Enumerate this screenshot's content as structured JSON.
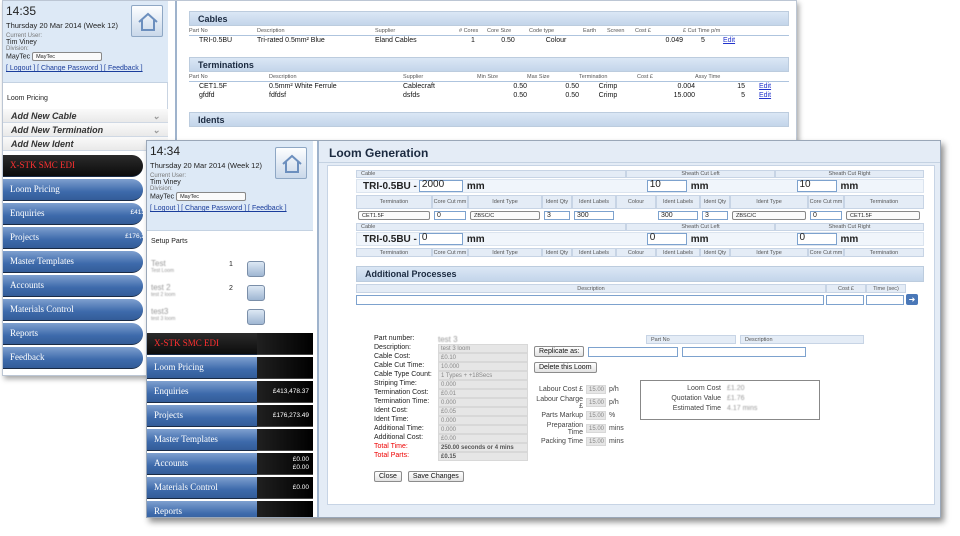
{
  "back_window": {
    "clock": "14:35",
    "date": "Thursday 20 Mar 2014 (Week 12)",
    "current_user_label": "Current User:",
    "user": "Tim Viney",
    "division_label": "Division:",
    "division": "MayTec",
    "division_select": "MayTec",
    "links": "[ Logout ] [ Change Password ] [ Feedback ]",
    "sidebar_title": "Loom Pricing",
    "add_items": [
      "Add New Cable",
      "Add New Termination",
      "Add New Ident"
    ],
    "nav": [
      "X-STK SMC EDI",
      "Loom Pricing",
      "Enquiries",
      "Projects",
      "Master Templates",
      "Accounts",
      "Materials Control",
      "Reports",
      "Feedback"
    ],
    "nav_values": [
      "",
      "",
      "£413",
      "£176,2",
      "",
      "",
      "",
      "",
      ""
    ],
    "cables": {
      "title": "Cables",
      "columns": [
        "Part No",
        "Description",
        "Supplier",
        "# Cores",
        "Core Size",
        "Code type",
        "Earth",
        "Screen",
        "Cost £",
        "£ Cut Time p/m"
      ],
      "row": [
        "TRI-0.5BU",
        "Tri-rated 0.5mm² Blue",
        "Eland Cables",
        "1",
        "0.50",
        "Colour",
        "",
        "",
        "0.049",
        "5"
      ],
      "edit": "Edit"
    },
    "terminations": {
      "title": "Terminations",
      "columns": [
        "Part No",
        "Description",
        "Supplier",
        "Min Size",
        "Max Size",
        "Termination",
        "Cost £",
        "Assy Time"
      ],
      "rows": [
        [
          "CET1.5F",
          "0.5mm² White Ferrule",
          "Cablecraft",
          "0.50",
          "0.50",
          "Crimp",
          "0.004",
          "15"
        ],
        [
          "gfdfd",
          "fdfdsf",
          "dsfds",
          "0.50",
          "0.50",
          "Crimp",
          "15.000",
          "5"
        ]
      ],
      "edit": "Edit"
    },
    "idents": {
      "title": "Idents"
    }
  },
  "front_window": {
    "clock": "14:34",
    "date": "Thursday 20 Mar 2014 (Week 12)",
    "current_user_label": "Current User:",
    "user": "Tim Viney",
    "division_label": "Division:",
    "division": "MayTec",
    "division_select": "MayTec",
    "links": "[ Logout ] [ Change Password ] [ Feedback ]",
    "setup_title": "Setup Parts",
    "setup_parts": [
      {
        "name": "Test",
        "sub": "Test Loom",
        "qty": "1"
      },
      {
        "name": "test 2",
        "sub": "test 2 loom",
        "qty": "2"
      },
      {
        "name": "test3",
        "sub": "test 3 loom",
        "qty": ""
      }
    ],
    "nav": [
      "X-STK SMC EDI",
      "Loom Pricing",
      "Enquiries",
      "Projects",
      "Master Templates",
      "Accounts",
      "Materials Control",
      "Reports"
    ],
    "nav_values": [
      "",
      "",
      "£413,478.37",
      "£176,273.49",
      "",
      "£0.00\n£0.00",
      "£0.00",
      ""
    ],
    "loom_title": "Loom Generation",
    "cable_header": "Cable",
    "sheath_left_header": "Sheath Cut Left",
    "sheath_right_header": "Sheath Cut Right",
    "cable1": {
      "part": "TRI-0.5BU -",
      "length": "2000",
      "unit": "mm",
      "sheath_left": "10",
      "sheath_left_unit": "mm",
      "sheath_right": "10",
      "sheath_right_unit": "mm"
    },
    "term_columns": [
      "Termination",
      "Core Cut mm",
      "Ident Type",
      "Ident Qty",
      "Ident Labels",
      "Colour",
      "Ident Labels",
      "Ident Qty",
      "Ident Type",
      "Core Cut mm",
      "Termination"
    ],
    "term_values": [
      "CET1.5F",
      "0",
      "ZBSC/C",
      "3",
      "300",
      "",
      "300",
      "3",
      "ZBSC/C",
      "0",
      "CET1.5F"
    ],
    "cable2": {
      "part": "TRI-0.5BU -",
      "length": "0",
      "unit": "mm",
      "sheath_left": "0",
      "sheath_left_unit": "mm",
      "sheath_right": "0",
      "sheath_right_unit": "mm"
    },
    "additional_title": "Additional Processes",
    "add_cols": [
      "Description",
      "Cost £",
      "Time (sec)"
    ],
    "summary_labels": [
      "Part number:",
      "Description:",
      "Cable Cost:",
      "Cable Cut Time:",
      "Cable Type Count:",
      "Striping Time:",
      "Termination Cost:",
      "Termination Time:",
      "Ident Cost:",
      "Ident Time:",
      "Additional Time:",
      "Additional Cost:",
      "Total Time:",
      "Total Parts:"
    ],
    "summary_values": [
      "test 3",
      "test 3 loom",
      "£0.10",
      "10.000",
      "1 Types + +18Secs",
      "0.000",
      "£0.01",
      "0.000",
      "£0.05",
      "0.000",
      "0.000",
      "£0.00",
      "250.00 seconds or 4 mins",
      "£0.15"
    ],
    "replicate_label": "Replicate as:",
    "replicate_cols": [
      "Part No",
      "Description"
    ],
    "delete_label": "Delete this Loom",
    "rates": [
      [
        "Labour Cost £",
        "15.00",
        "p/h"
      ],
      [
        "Labour Charge £",
        "15.00",
        "p/h"
      ],
      [
        "Parts Markup",
        "15.00",
        "%"
      ],
      [
        "Preparation Time",
        "15.00",
        "mins"
      ],
      [
        "Packing Time",
        "15.00",
        "mins"
      ]
    ],
    "results": [
      [
        "Loom Cost",
        "£1.20"
      ],
      [
        "Quotation Value",
        "£1.76"
      ],
      [
        "Estimated Time",
        "4.17 mins"
      ]
    ],
    "close_label": "Close",
    "save_label": "Save Changes"
  }
}
